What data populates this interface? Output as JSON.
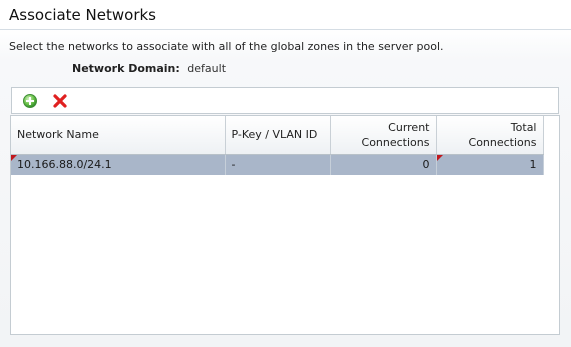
{
  "page": {
    "title": "Associate Networks",
    "instructions": "Select the networks to associate with all of the global zones in the server pool.",
    "network_domain_label": "Network Domain:",
    "network_domain_value": "default"
  },
  "toolbar": {
    "add_icon": "add-icon",
    "remove_icon": "remove-icon",
    "add_color": "#3aa03a",
    "remove_color": "#e02020"
  },
  "table": {
    "columns": [
      {
        "line1": "Network Name",
        "line2": ""
      },
      {
        "line1": "P-Key / VLAN ID",
        "line2": ""
      },
      {
        "line1": "Current",
        "line2": "Connections"
      },
      {
        "line1": "Total",
        "line2": "Connections"
      }
    ],
    "rows": [
      {
        "network_name": "10.166.88.0/24.1",
        "pkey_vlan": "-",
        "current_connections": "0",
        "total_connections": "1",
        "selected": true
      }
    ],
    "selected_row_color": "#a9b6c9",
    "flag_color": "#c0181e"
  }
}
